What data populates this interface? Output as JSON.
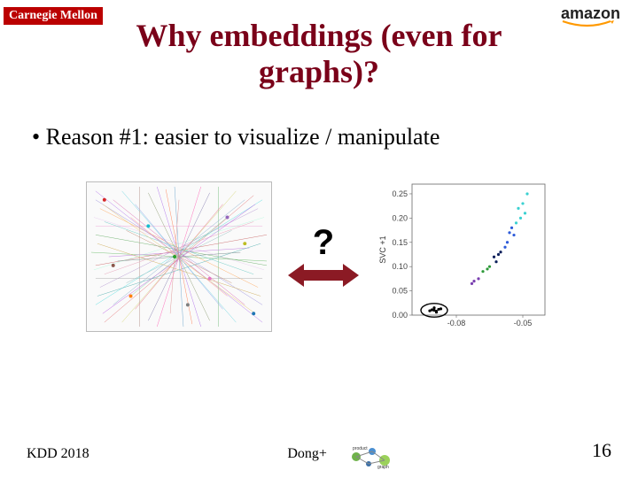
{
  "logos": {
    "cmu_text": "Carnegie Mellon",
    "amazon_text": "amazon"
  },
  "title": "Why embeddings (even for graphs)?",
  "bullet_text": "Reason #1: easier to visualize / manipulate",
  "arrow_symbol": "?",
  "footer": {
    "left": "KDD 2018",
    "center": "Dong+",
    "page": "16"
  },
  "chart_data": {
    "type": "scatter",
    "title": "",
    "xlabel": "",
    "ylabel": "SVC +1",
    "xlim": [
      -0.1,
      -0.04
    ],
    "ylim": [
      0.0,
      0.27
    ],
    "xticks": [
      -0.08,
      -0.05
    ],
    "yticks": [
      0.0,
      0.05,
      0.1,
      0.15,
      0.2,
      0.25
    ],
    "series": [
      {
        "name": "cluster-cyan",
        "color": "#3bd1d1",
        "points": [
          [
            -0.048,
            0.25
          ],
          [
            -0.05,
            0.23
          ],
          [
            -0.052,
            0.22
          ],
          [
            -0.049,
            0.21
          ],
          [
            -0.051,
            0.2
          ],
          [
            -0.053,
            0.19
          ]
        ]
      },
      {
        "name": "cluster-blue",
        "color": "#2e5bd9",
        "points": [
          [
            -0.055,
            0.18
          ],
          [
            -0.056,
            0.17
          ],
          [
            -0.054,
            0.165
          ],
          [
            -0.057,
            0.15
          ],
          [
            -0.058,
            0.14
          ]
        ]
      },
      {
        "name": "cluster-navy",
        "color": "#0a1e5a",
        "points": [
          [
            -0.06,
            0.13
          ],
          [
            -0.061,
            0.125
          ],
          [
            -0.063,
            0.12
          ],
          [
            -0.062,
            0.11
          ]
        ]
      },
      {
        "name": "cluster-green",
        "color": "#2e9a3a",
        "points": [
          [
            -0.065,
            0.1
          ],
          [
            -0.066,
            0.095
          ],
          [
            -0.068,
            0.09
          ]
        ]
      },
      {
        "name": "cluster-purple",
        "color": "#7a3fb0",
        "points": [
          [
            -0.07,
            0.075
          ],
          [
            -0.072,
            0.07
          ],
          [
            -0.073,
            0.065
          ]
        ]
      },
      {
        "name": "cluster-dense",
        "color": "#000000",
        "points": [
          [
            -0.09,
            0.01
          ],
          [
            -0.088,
            0.012
          ],
          [
            -0.089,
            0.008
          ],
          [
            -0.091,
            0.011
          ],
          [
            -0.087,
            0.013
          ],
          [
            -0.092,
            0.009
          ],
          [
            -0.09,
            0.015
          ],
          [
            -0.089,
            0.006
          ]
        ]
      }
    ],
    "ellipse": {
      "cx": -0.09,
      "cy": 0.01,
      "rx": 0.006,
      "ry": 0.014
    }
  }
}
